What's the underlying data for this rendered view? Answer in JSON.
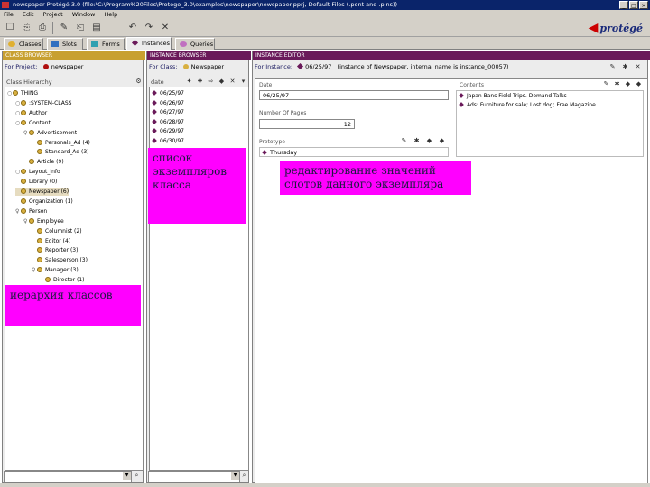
{
  "window": {
    "title": "newspaper  Protégé 3.0     (file:\\C:\\Program%20Files\\Protege_3.0\\examples\\newspaper\\newspaper.pprj, Default Files (.pont and .pins))",
    "minimize": "_",
    "maximize": "□",
    "close": "×"
  },
  "menu": [
    "File",
    "Edit",
    "Project",
    "Window",
    "Help"
  ],
  "toolbar_icons": [
    "new-icon",
    "open-icon",
    "save-icon",
    "cut-icon",
    "copy-icon",
    "paste-icon",
    "undo-icon",
    "redo-icon",
    "delete-icon"
  ],
  "toolbar_glyphs": [
    "☐",
    "⎘",
    "⎙",
    "✎",
    "⎗",
    "▤",
    "↶",
    "↷",
    "✕"
  ],
  "logo": {
    "word": "protégé",
    "mark": "◀"
  },
  "tabs": [
    {
      "label": "Classes",
      "color": "#e0b030"
    },
    {
      "label": "Slots",
      "color": "#3070c0"
    },
    {
      "label": "Forms",
      "color": "#30a0b0"
    },
    {
      "label": "Instances",
      "color": "#6a1a5a"
    },
    {
      "label": "Queries",
      "color": "#c070c0"
    }
  ],
  "class_browser": {
    "header": "CLASS BROWSER",
    "for_project_label": "For Project:",
    "project_name": "newspaper",
    "hierarchy_label": "Class Hierarchy",
    "header_color": "#c8a030",
    "rows": [
      {
        "toggle": "○",
        "label": "THING",
        "indent": 0
      },
      {
        "toggle": "○",
        "label": ":SYSTEM-CLASS",
        "indent": 1
      },
      {
        "toggle": "○",
        "label": "Author",
        "indent": 1
      },
      {
        "toggle": "○",
        "label": "Content",
        "indent": 1
      },
      {
        "toggle": "♀",
        "label": "Advertisement",
        "indent": 2
      },
      {
        "toggle": "",
        "label": "Personals_Ad  (4)",
        "indent": 3
      },
      {
        "toggle": "",
        "label": "Standard_Ad  (3)",
        "indent": 3
      },
      {
        "toggle": "",
        "label": "Article  (9)",
        "indent": 2
      },
      {
        "toggle": "○",
        "label": "Layout_info",
        "indent": 1
      },
      {
        "toggle": "",
        "label": "Library  (0)",
        "indent": 1
      },
      {
        "toggle": "",
        "label": "Newspaper  (6)",
        "indent": 1,
        "selected": true
      },
      {
        "toggle": "",
        "label": "Organization  (1)",
        "indent": 1
      },
      {
        "toggle": "♀",
        "label": "Person",
        "indent": 1
      },
      {
        "toggle": "♀",
        "label": "Employee",
        "indent": 2
      },
      {
        "toggle": "",
        "label": "Columnist  (2)",
        "indent": 3
      },
      {
        "toggle": "",
        "label": "Editor  (4)",
        "indent": 3
      },
      {
        "toggle": "",
        "label": "Reporter  (3)",
        "indent": 3
      },
      {
        "toggle": "",
        "label": "Salesperson  (3)",
        "indent": 3
      },
      {
        "toggle": "♀",
        "label": "Manager  (3)",
        "indent": 3
      },
      {
        "toggle": "",
        "label": "Director  (1)",
        "indent": 4
      }
    ]
  },
  "instance_browser": {
    "header": "INSTANCE BROWSER",
    "for_class_label": "For Class:",
    "class_name": "Newspaper",
    "list_label": "date",
    "header_color": "#6a1a5a",
    "instances": [
      "06/25/97",
      "06/26/97",
      "06/27/97",
      "06/28/97",
      "06/29/97",
      "06/30/97"
    ]
  },
  "instance_editor": {
    "header": "INSTANCE EDITOR",
    "for_instance_label": "For Instance:",
    "instance_name": "06/25/97",
    "instance_info": "(instance of Newspaper, internal name is instance_00057)",
    "date_label": "Date",
    "date_value": "06/25/97",
    "pages_label": "Number Of Pages",
    "pages_value": "12",
    "prototype_label": "Prototype",
    "prototype_value": "Thursday",
    "contents_label": "Contents",
    "contents": [
      "Japan Bans Field Trips. Demand Talks",
      "Ads: Furniture for sale; Lost dog; Free Magazine"
    ]
  },
  "callouts": {
    "instances": "список экземпляров класса",
    "editor": "редактирование значений слотов данного экземпляра",
    "hierarchy": "иерархия классов"
  }
}
